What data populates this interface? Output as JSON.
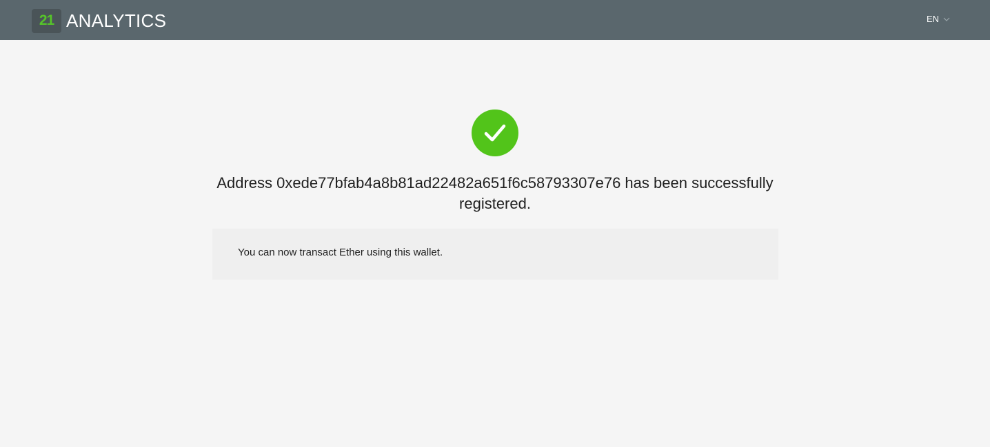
{
  "header": {
    "logo_mark": "21",
    "logo_text": "ANALYTICS",
    "language": "EN"
  },
  "colors": {
    "header_bg": "#5a676d",
    "logo_green": "#56c42a",
    "success_green": "#52c41a"
  },
  "icons": {
    "success": "check-circle-icon",
    "language_dropdown": "chevron-down-icon"
  },
  "main": {
    "message": "Address 0xede77bfab4a8b81ad22482a651f6c58793307e76 has been successfully registered.",
    "info_text": "You can now transact Ether using this wallet."
  }
}
